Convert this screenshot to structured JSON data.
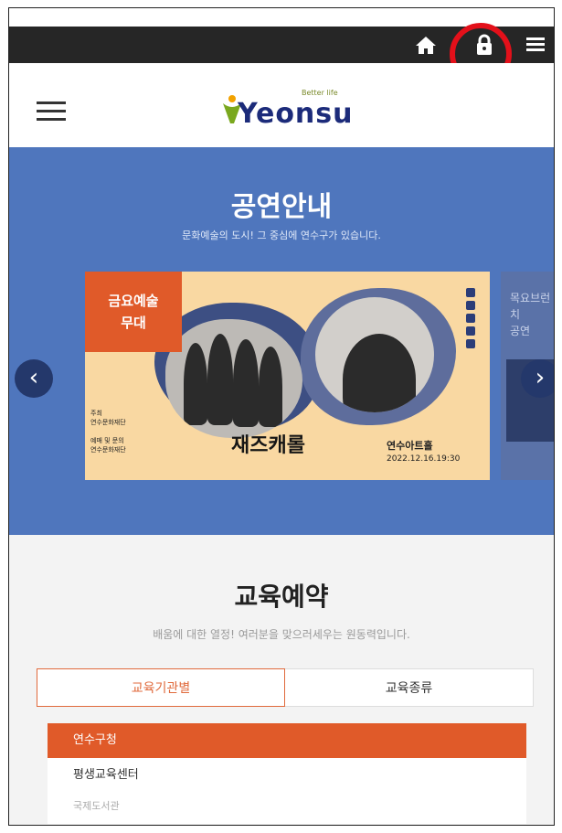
{
  "topbar": {
    "icons": [
      "home-icon",
      "lock-icon",
      "menu-icon"
    ],
    "highlight_color": "#e3101a"
  },
  "header": {
    "logo_tagline": "Better life",
    "logo_text": "Yeonsu"
  },
  "performance": {
    "title": "공연안내",
    "subtitle": "문화예술의 도시! 그 중심에 연수구가 있습니다.",
    "slide": {
      "badge": "금요예술\n무대",
      "title": "재즈캐롤",
      "small_left_1": "주최\n연수문화재단",
      "small_left_2": "예매 및 문의\n연수문화재단",
      "venue": "연수아트홀",
      "date": "2022.12.16.19:30"
    },
    "next_slide_text": "목요브런치\n공연",
    "prev_arrow": "‹",
    "next_arrow": "›",
    "bg_color": "#4f76bd"
  },
  "education": {
    "title": "교육예약",
    "subtitle": "배움에 대한 열정! 여러분을 맞으러세우는 원동력입니다.",
    "tabs": [
      {
        "label": "교육기관별",
        "active": true
      },
      {
        "label": "교육종류",
        "active": false
      }
    ],
    "list": [
      {
        "label": "연수구청",
        "selected": true
      },
      {
        "label": "평생교육센터",
        "selected": false
      },
      {
        "label": "국제도서관",
        "selected": false
      }
    ],
    "accent_color": "#e05a29"
  }
}
